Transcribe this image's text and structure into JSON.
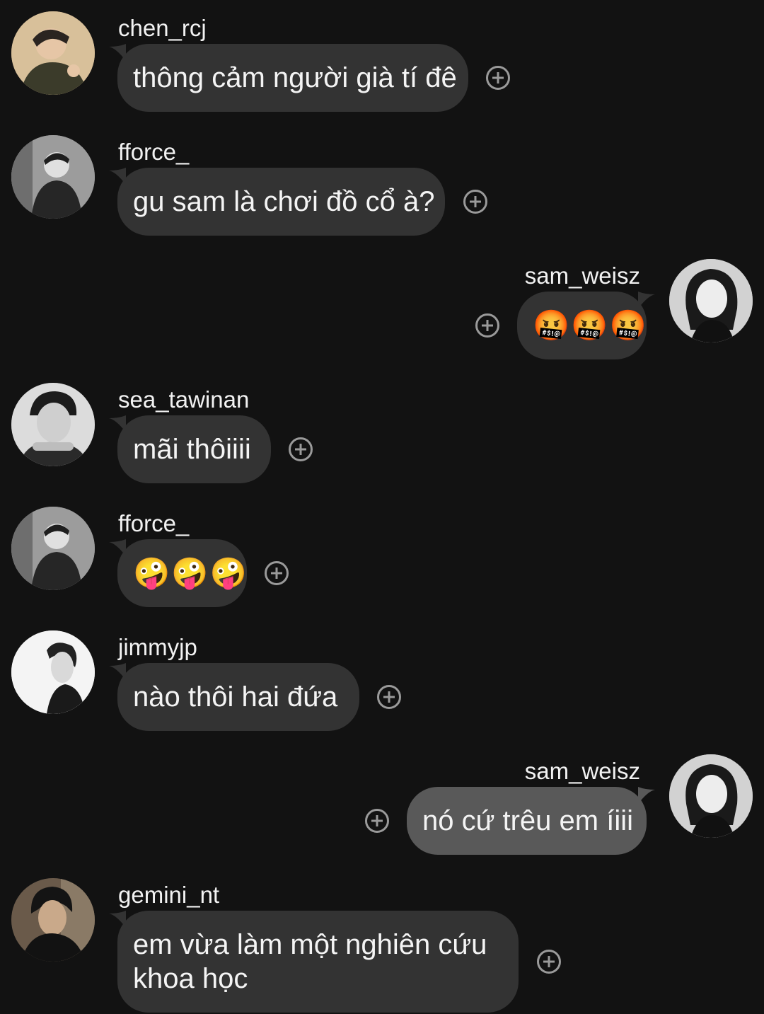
{
  "messages": [
    {
      "user": "chen_rcj",
      "text": "thông cảm người già tí đê",
      "side": "left",
      "avatar": "avatar-chen-rcj"
    },
    {
      "user": "fforce_",
      "text": "gu sam là chơi đồ cổ à?",
      "side": "left",
      "avatar": "avatar-fforce"
    },
    {
      "user": "sam_weisz",
      "text": "🤬🤬🤬",
      "side": "right",
      "avatar": "avatar-sam-weisz"
    },
    {
      "user": "sea_tawinan",
      "text": "mãi thôiiii",
      "side": "left",
      "avatar": "avatar-sea-tawinan"
    },
    {
      "user": "fforce_",
      "text": "🤪🤪🤪",
      "side": "left",
      "avatar": "avatar-fforce"
    },
    {
      "user": "jimmyjp",
      "text": "nào thôi hai đứa",
      "side": "left",
      "avatar": "avatar-jimmyjp"
    },
    {
      "user": "sam_weisz",
      "text": "nó cứ trêu em íiii",
      "side": "right",
      "avatar": "avatar-sam-weisz"
    },
    {
      "user": "gemini_nt",
      "text_line1": "em vừa làm một nghiên cứu",
      "text_line2": "khoa học",
      "side": "left",
      "avatar": "avatar-gemini-nt"
    }
  ],
  "icons": {
    "add_reaction": "add-reaction-icon"
  },
  "colors": {
    "background": "#121212",
    "bubble_other": "#333333",
    "bubble_me": "#595959",
    "text": "#f4f4f4",
    "icon": "#9a9a9a"
  }
}
